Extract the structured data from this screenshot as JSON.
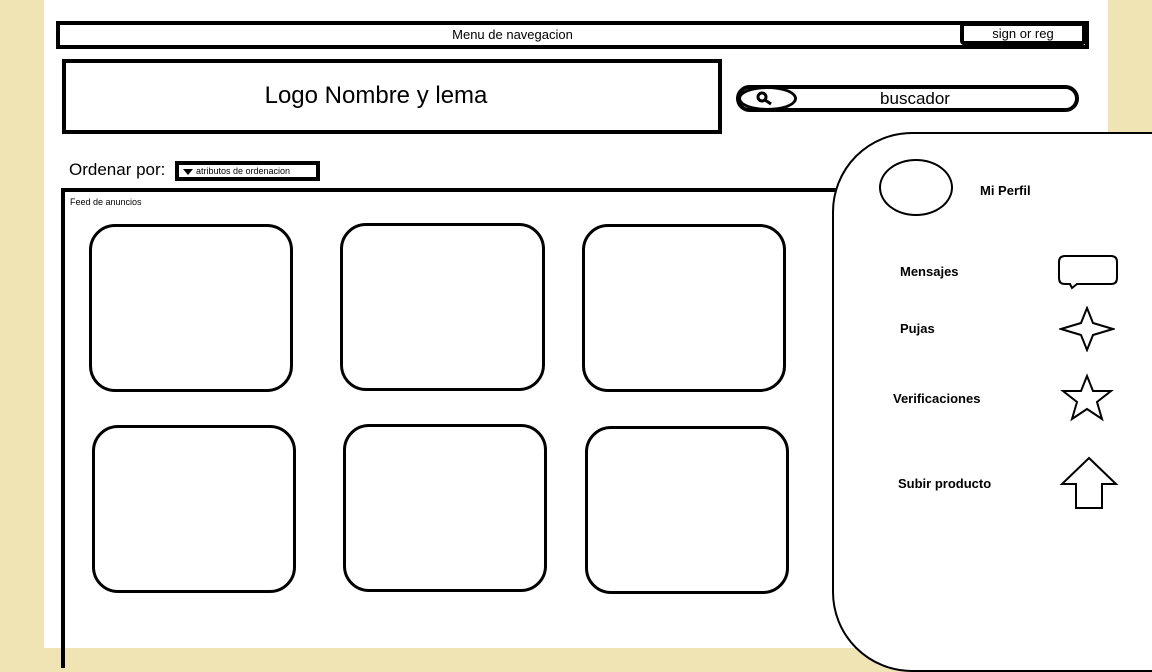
{
  "navbar": {
    "title": "Menu de navegacion",
    "signin_label": "sign or reg"
  },
  "header": {
    "logo_text": "Logo Nombre y lema"
  },
  "search": {
    "label": "buscador",
    "icon": "search-icon"
  },
  "sort": {
    "label": "Ordenar por:",
    "selected": "atributos de ordenacion"
  },
  "feed": {
    "label": "Feed de anuncios",
    "card_count": 6
  },
  "sidebar": {
    "profile_label": "Mi Perfil",
    "items": [
      {
        "label": "Mensajes",
        "icon": "speech-bubble-icon"
      },
      {
        "label": "Pujas",
        "icon": "four-point-star-icon"
      },
      {
        "label": "Verificaciones",
        "icon": "star-icon"
      },
      {
        "label": "Subir producto",
        "icon": "up-arrow-icon"
      }
    ]
  },
  "colors": {
    "margin_background": "#f0e4b4",
    "page_background": "#ffffff",
    "stroke": "#000000"
  }
}
